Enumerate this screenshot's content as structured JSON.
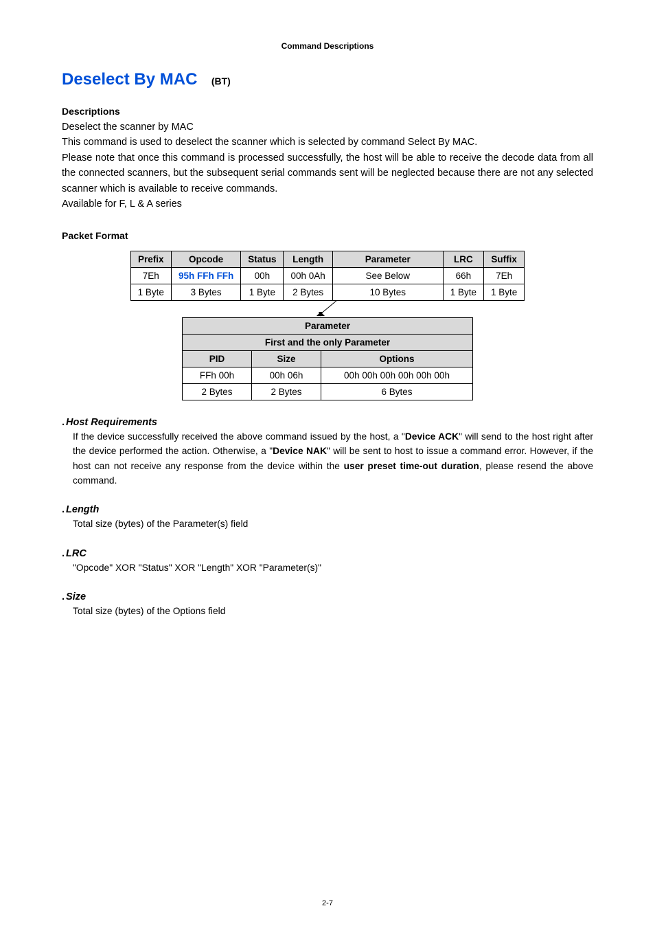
{
  "header": "Command Descriptions",
  "title": {
    "main": "Deselect By MAC",
    "sub": "(BT)"
  },
  "desc": {
    "label": "Descriptions",
    "line1": "Deselect the scanner by MAC",
    "line2": "This command is used to deselect the scanner which is selected by command Select By MAC.",
    "line3": "Please note that once this command is processed successfully, the host will be able to receive the decode data from all the connected scanners, but the subsequent serial commands sent will be neglected because there are not any selected scanner which is available to receive commands.",
    "line4": "Available for F, L & A series"
  },
  "packet": {
    "label": "Packet Format",
    "hdr": {
      "prefix": "Prefix",
      "opcode": "Opcode",
      "status": "Status",
      "length": "Length",
      "parameter": "Parameter",
      "lrc": "LRC",
      "suffix": "Suffix"
    },
    "row1": {
      "prefix": "7Eh",
      "opcode": "95h FFh FFh",
      "status": "00h",
      "length": "00h 0Ah",
      "parameter": "See Below",
      "lrc": "66h",
      "suffix": "7Eh"
    },
    "row2": {
      "prefix": "1 Byte",
      "opcode": "3 Bytes",
      "status": "1 Byte",
      "length": "2 Bytes",
      "parameter": "10 Bytes",
      "lrc": "1 Byte",
      "suffix": "1 Byte"
    }
  },
  "param": {
    "top": "Parameter",
    "first": "First and the only Parameter",
    "hdr": {
      "pid": "PID",
      "size": "Size",
      "options": "Options"
    },
    "row1": {
      "pid": "FFh 00h",
      "size": "00h 06h",
      "options": "00h 00h 00h 00h 00h 00h"
    },
    "row2": {
      "pid": "2 Bytes",
      "size": "2 Bytes",
      "options": "6 Bytes"
    }
  },
  "hostreq": {
    "title": "Host Requirements",
    "text_a": "If the device successfully received the above command issued by the host, a \"",
    "ack": "Device ACK",
    "text_b": "\" will send to the host right after the device performed the action. Otherwise, a \"",
    "nak": "Device NAK",
    "text_c": "\" will be sent to host to issue a command error. However, if the host can not receive any response from the device within the ",
    "preset": "user preset time-out duration",
    "text_d": ", please resend the above command."
  },
  "length": {
    "title": "Length",
    "text": "Total size (bytes) of the Parameter(s) field"
  },
  "lrc": {
    "title": "LRC",
    "text": "\"Opcode\" XOR \"Status\" XOR \"Length\" XOR \"Parameter(s)\""
  },
  "size": {
    "title": "Size",
    "text": "Total size (bytes) of the Options field"
  },
  "footer": "2-7",
  "dot": "."
}
